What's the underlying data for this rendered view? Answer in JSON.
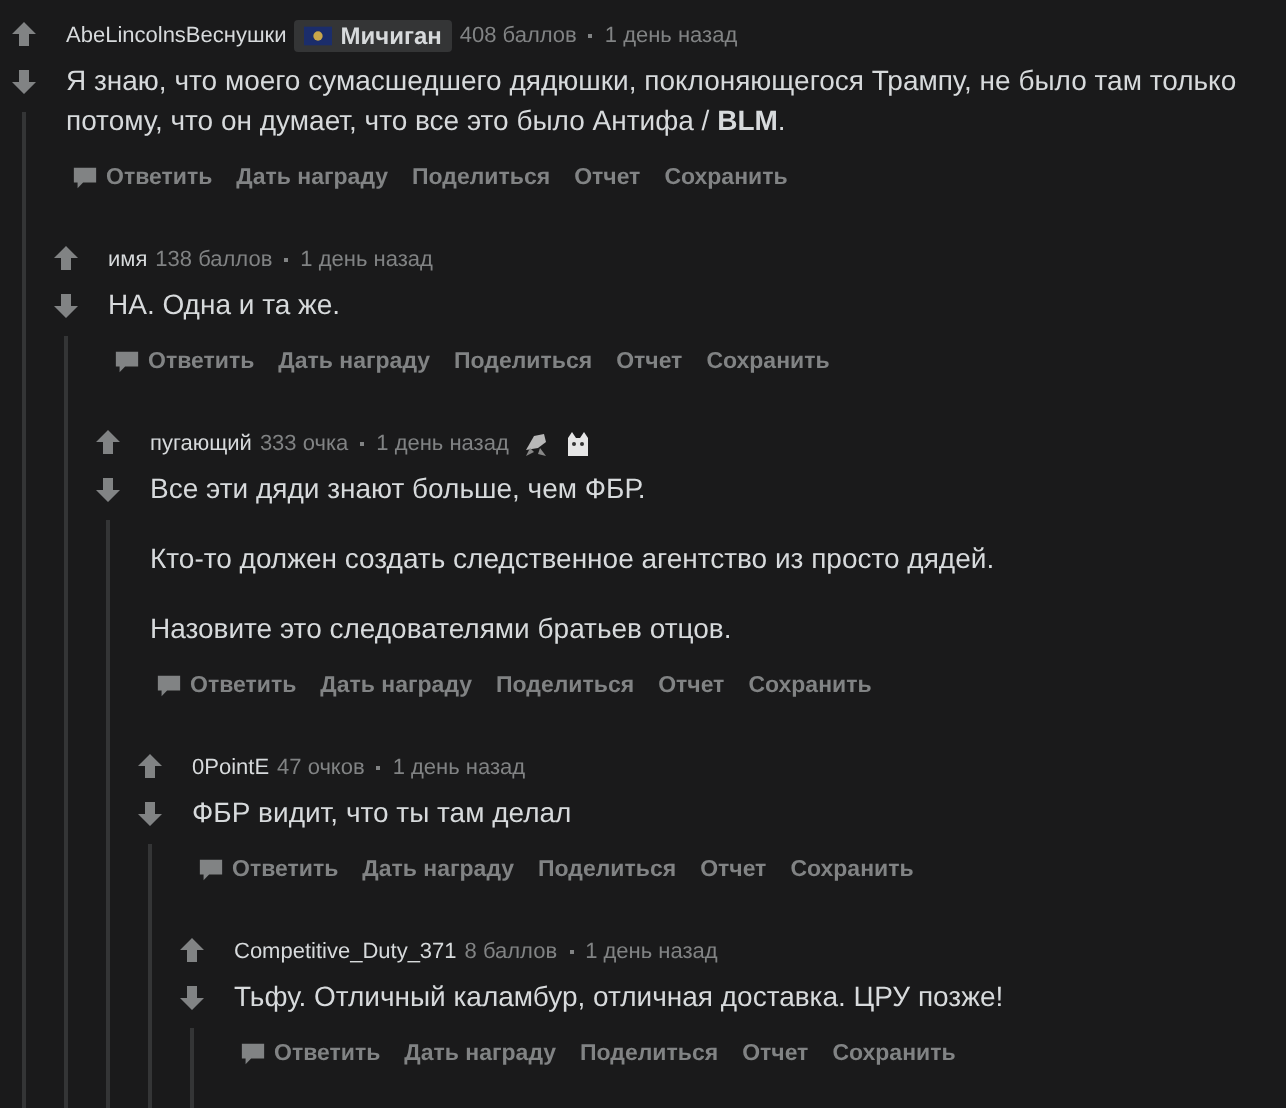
{
  "comments": [
    {
      "author": "AbeLincolnsВеснушки",
      "flair": {
        "text": "Мичиган"
      },
      "score": "408 баллов",
      "time": "1 день назад",
      "body": [
        "Я знаю, что моего сумасшедшего дядюшки, поклоняющегося Трампу, не было там только потому, что он думает, что все это было Антифа / **BLM**."
      ],
      "actions": [
        "Ответить",
        "Дать награду",
        "Поделиться",
        "Отчет",
        "Сохранить"
      ],
      "children": [
        {
          "author": "имя",
          "score": "138 баллов",
          "time": "1 день назад",
          "body": [
            "НА. Одна и та же."
          ],
          "actions": [
            "Ответить",
            "Дать награду",
            "Поделиться",
            "Отчет",
            "Сохранить"
          ],
          "children": [
            {
              "author": "пугающий",
              "score": "333 очка",
              "time": "1 день назад",
              "awards": [
                {
                  "kind": "ribbon"
                },
                {
                  "kind": "cat"
                }
              ],
              "body": [
                "Все эти дяди знают больше, чем ФБР.",
                "Кто-то должен создать следственное агентство из просто дядей.",
                "Назовите это следователями братьев отцов."
              ],
              "actions": [
                "Ответить",
                "Дать награду",
                "Поделиться",
                "Отчет",
                "Сохранить"
              ],
              "children": [
                {
                  "author": "0PointE",
                  "score": "47 очков",
                  "time": "1 день назад",
                  "body": [
                    "ФБР видит, что ты там делал"
                  ],
                  "actions": [
                    "Ответить",
                    "Дать награду",
                    "Поделиться",
                    "Отчет",
                    "Сохранить"
                  ],
                  "children": [
                    {
                      "author": "Competitive_Duty_371",
                      "score": "8 баллов",
                      "time": "1 день назад",
                      "body": [
                        "Тьфу. Отличный каламбур, отличная доставка. ЦРУ позже!"
                      ],
                      "actions": [
                        "Ответить",
                        "Дать награду",
                        "Поделиться",
                        "Отчет",
                        "Сохранить"
                      ]
                    }
                  ]
                }
              ]
            }
          ]
        }
      ]
    }
  ]
}
